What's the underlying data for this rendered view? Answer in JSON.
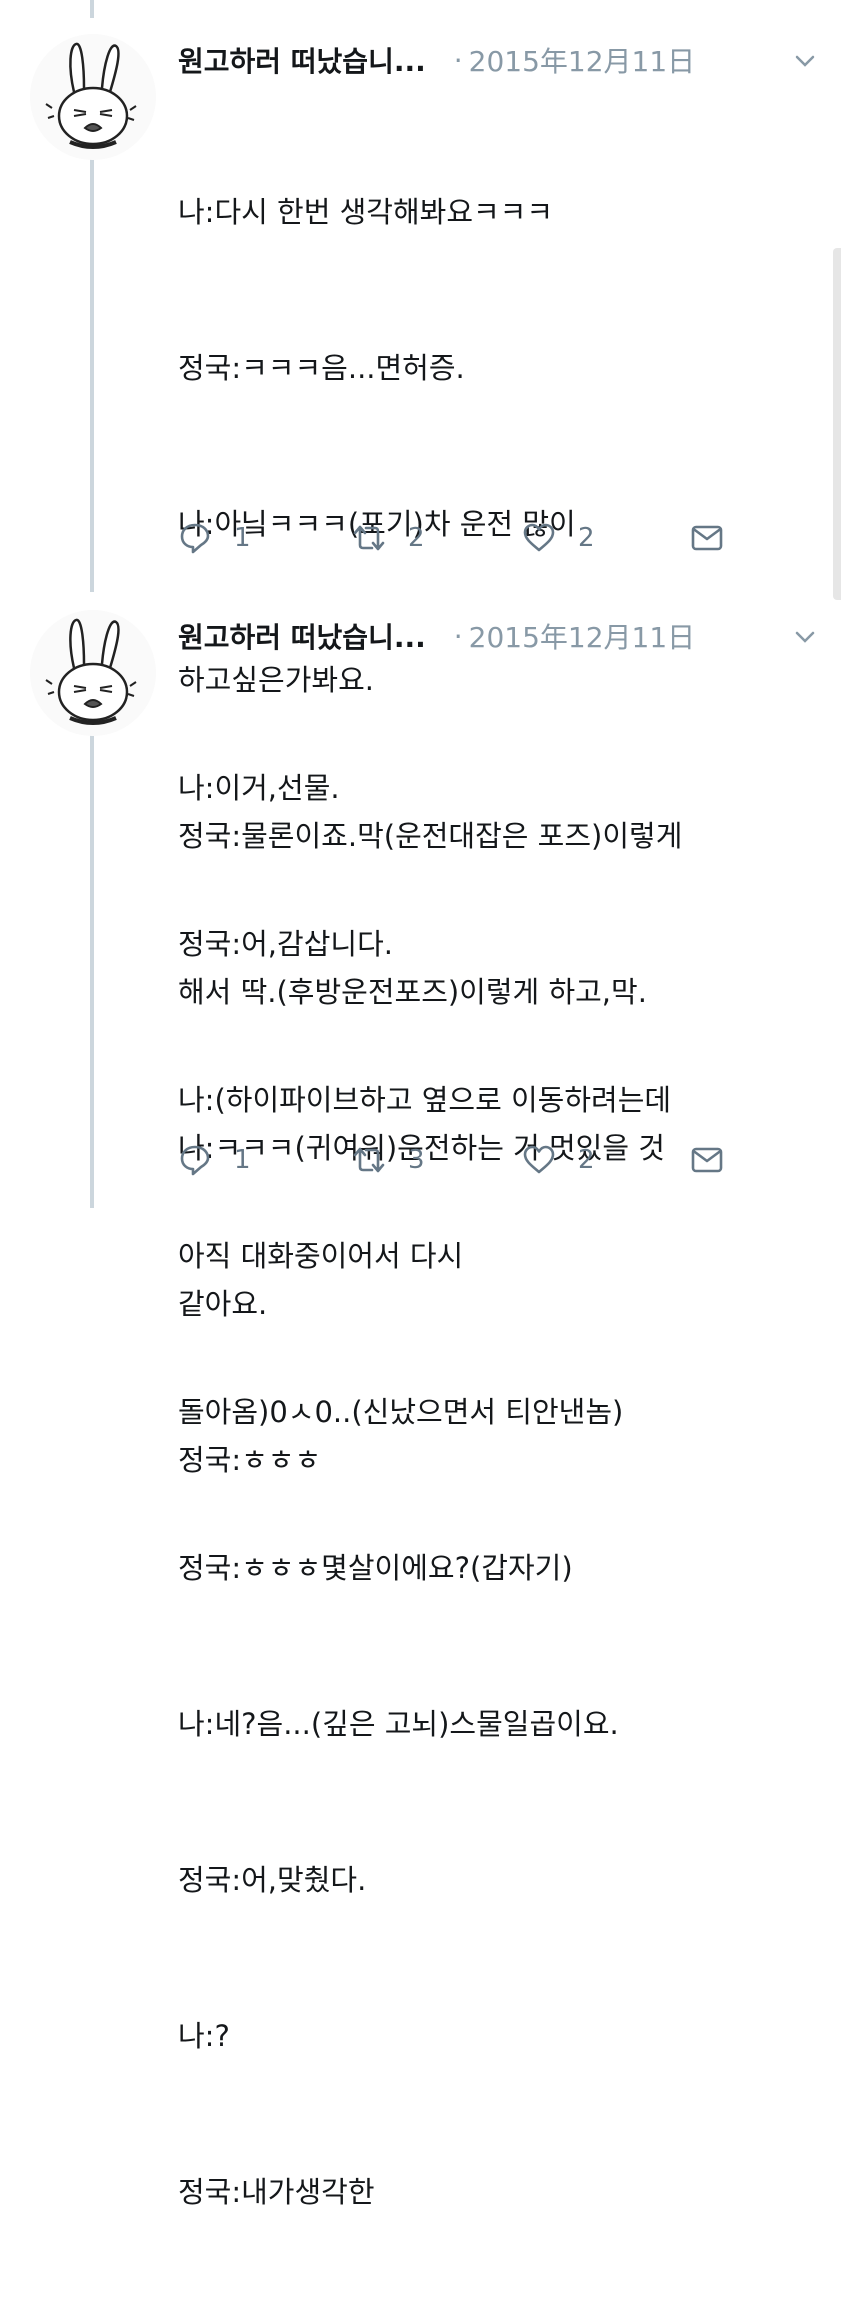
{
  "tweets": [
    {
      "author": "원고하러 떠났습니...",
      "separator": "·",
      "date": "2015年12月11日",
      "lines": [
        "나:다시 한번 생각해봐요ㅋㅋㅋ",
        "정국:ㅋㅋㅋ음...면허증.",
        "나:아닠ㅋㅋㅋ(포기)차 운전 많이",
        "하고싶은가봐요.",
        "정국:물론이죠.막(운전대잡은 포즈)이렇게",
        "해서 딱.(후방운전포즈)이렇게 하고,막.",
        "나:ㅋㅋㅋ(귀여워)운전하는 거 멋있을 것",
        "같아요.",
        "정국:ㅎㅎㅎ"
      ],
      "replies": "1",
      "retweets": "2",
      "likes": "2"
    },
    {
      "author": "원고하러 떠났습니...",
      "separator": "·",
      "date": "2015年12月11日",
      "lines": [
        "나:이거,선물.",
        "정국:어,감삽니다.",
        "나:(하이파이브하고 옆으로 이동하려는데",
        "아직 대화중이어서 다시",
        "돌아옴)0ㅅ0..(신났으면서 티안낸놈)",
        "정국:ㅎㅎㅎ몇살이에요?(갑자기)",
        "나:네?음...(깊은 고뇌)스물일곱이요.",
        "정국:어,맞췄다.",
        "나:?",
        "정국:내가생각한"
      ],
      "replies": "1",
      "retweets": "3",
      "likes": "2"
    }
  ],
  "icons": {
    "avatar": "bunny-avatar",
    "menu": "chevron-down-icon",
    "reply": "reply-icon",
    "retweet": "retweet-icon",
    "like": "heart-icon",
    "dm": "envelope-icon"
  },
  "colors": {
    "text": "#14171a",
    "secondary": "#8899a6",
    "action": "#657786",
    "thread_line": "#ccd6dd"
  }
}
